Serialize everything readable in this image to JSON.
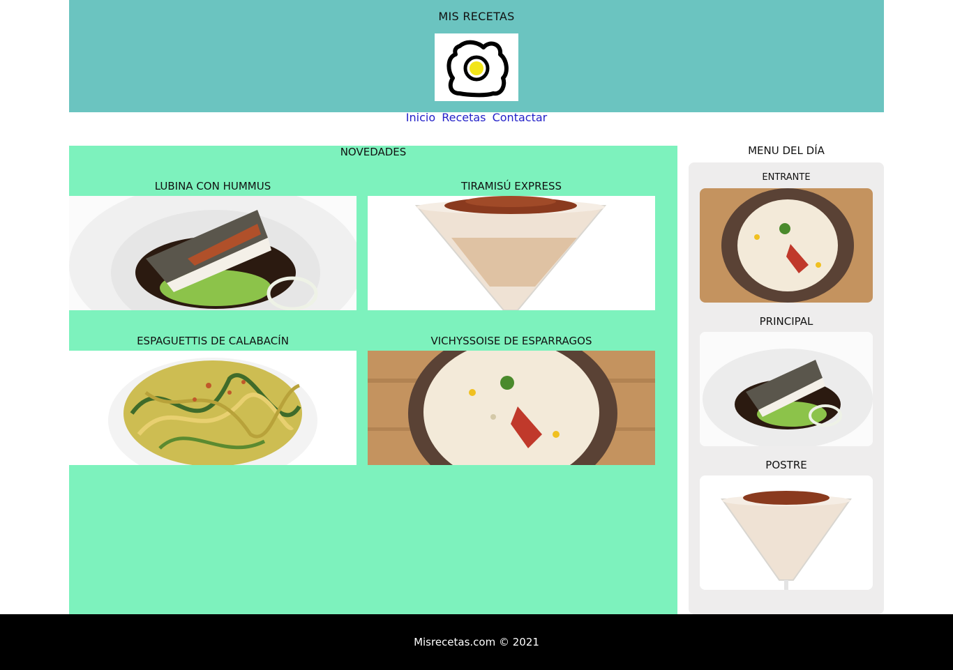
{
  "header": {
    "title": "MIS RECETAS",
    "logo_icon": "fried-egg-icon"
  },
  "nav": {
    "items": [
      "Inicio",
      "Recetas",
      "Contactar"
    ]
  },
  "main": {
    "title": "NOVEDADES",
    "recipes": [
      {
        "name": "LUBINA CON HUMMUS"
      },
      {
        "name": "TIRAMISÚ EXPRESS"
      },
      {
        "name": "ESPAGUETTIS DE CALABACÍN"
      },
      {
        "name": "VICHYSSOISE DE ESPARRAGOS"
      }
    ]
  },
  "sidebar": {
    "title": "MENU DEL DÍA",
    "starter_label": "ENTRANTE",
    "main_label": "PRINCIPAL",
    "dessert_label": "POSTRE"
  },
  "footer": {
    "text": "Misrecetas.com © 2021"
  },
  "colors": {
    "header_bg": "#6bc4c0",
    "main_bg": "#7df2bd",
    "sidebar_bg": "#eeeded",
    "link": "#2321c8",
    "footer_bg": "#000000"
  }
}
